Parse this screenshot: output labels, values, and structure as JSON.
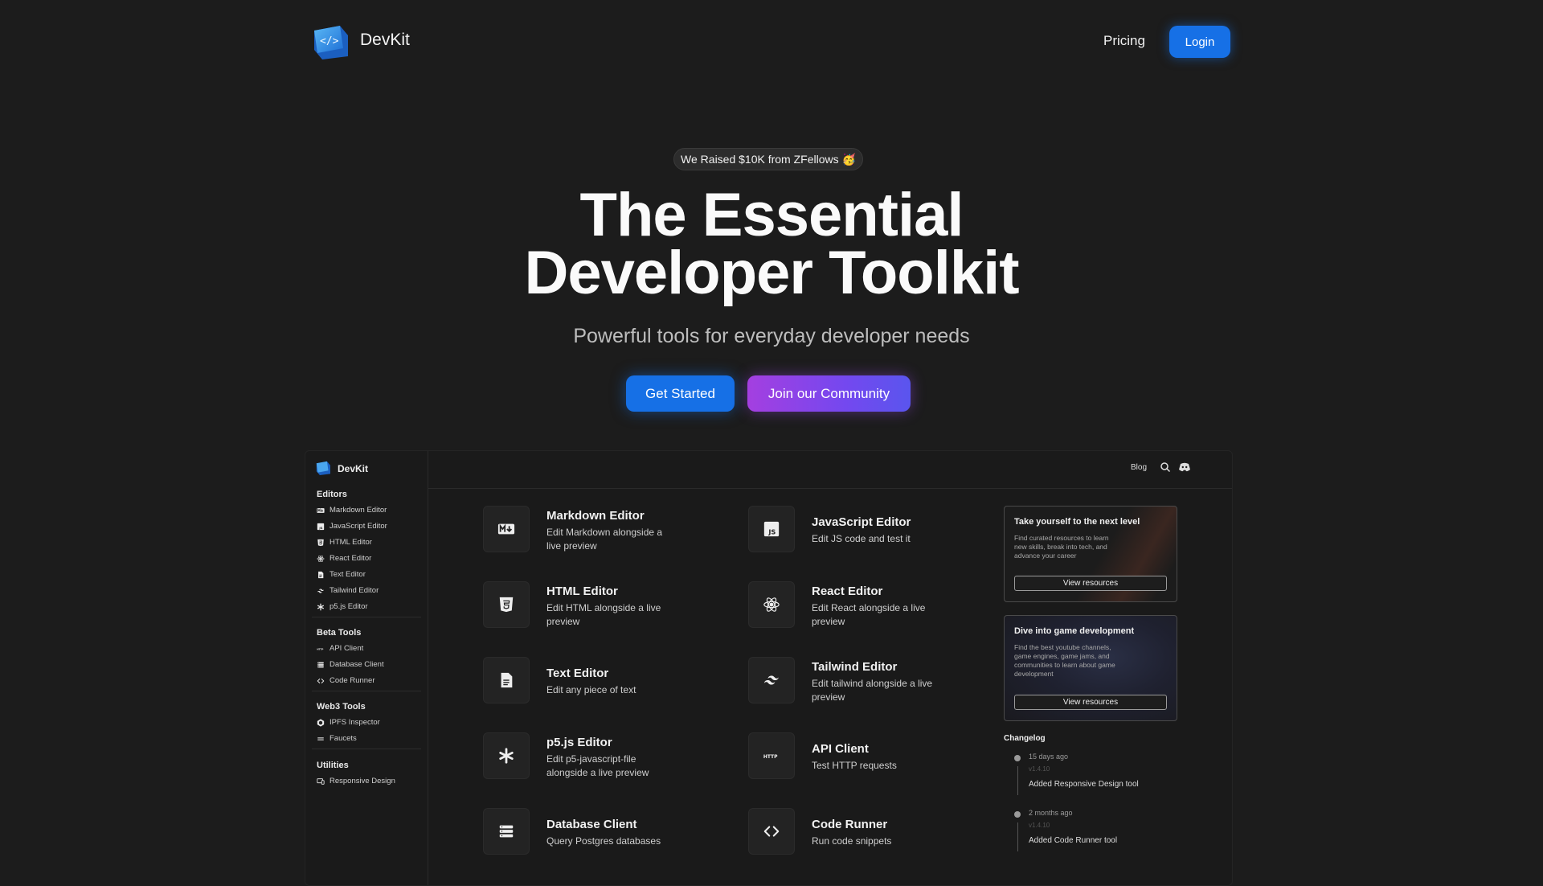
{
  "nav": {
    "brand": "DevKit",
    "pricing": "Pricing",
    "login": "Login"
  },
  "hero": {
    "badge": "We Raised $10K from ZFellows 🥳",
    "title_line1": "The Essential",
    "title_line2": "Developer Toolkit",
    "subtitle": "Powerful tools for everyday developer needs",
    "cta_primary": "Get Started",
    "cta_secondary": "Join our Community"
  },
  "colors": {
    "accent": "#1670e6",
    "community_gradient": [
      "#a43fe0",
      "#5a55ee"
    ],
    "background": "#1c1c1c"
  },
  "app": {
    "brand": "DevKit",
    "topbar": {
      "blog": "Blog",
      "search_icon": "search-icon",
      "discord_icon": "discord-icon"
    },
    "sidebar": {
      "sections": [
        {
          "title": "Editors",
          "items": [
            {
              "label": "Markdown Editor",
              "icon": "markdown-icon"
            },
            {
              "label": "JavaScript Editor",
              "icon": "javascript-icon"
            },
            {
              "label": "HTML Editor",
              "icon": "html5-icon"
            },
            {
              "label": "React Editor",
              "icon": "react-icon"
            },
            {
              "label": "Text Editor",
              "icon": "file-text-icon"
            },
            {
              "label": "Tailwind Editor",
              "icon": "tailwind-icon"
            },
            {
              "label": "p5.js Editor",
              "icon": "asterisk-icon"
            }
          ]
        },
        {
          "title": "Beta Tools",
          "items": [
            {
              "label": "API Client",
              "icon": "http-icon"
            },
            {
              "label": "Database Client",
              "icon": "database-icon"
            },
            {
              "label": "Code Runner",
              "icon": "code-icon"
            }
          ]
        },
        {
          "title": "Web3 Tools",
          "items": [
            {
              "label": "IPFS Inspector",
              "icon": "ipfs-icon"
            },
            {
              "label": "Faucets",
              "icon": "faucet-icon"
            }
          ]
        },
        {
          "title": "Utilities",
          "items": [
            {
              "label": "Responsive Design",
              "icon": "responsive-icon"
            }
          ]
        }
      ]
    },
    "tools": [
      {
        "title": "Markdown Editor",
        "desc": "Edit Markdown alongside a live preview",
        "icon": "markdown-icon"
      },
      {
        "title": "JavaScript Editor",
        "desc": "Edit JS code and test it",
        "icon": "javascript-icon"
      },
      {
        "title": "HTML Editor",
        "desc": "Edit HTML alongside a live preview",
        "icon": "html5-icon"
      },
      {
        "title": "React Editor",
        "desc": "Edit React alongside a live preview",
        "icon": "react-icon"
      },
      {
        "title": "Text Editor",
        "desc": "Edit any piece of text",
        "icon": "file-text-icon"
      },
      {
        "title": "Tailwind Editor",
        "desc": "Edit tailwind alongside a live preview",
        "icon": "tailwind-icon"
      },
      {
        "title": "p5.js Editor",
        "desc": "Edit p5-javascript-file alongside a live preview",
        "icon": "asterisk-icon"
      },
      {
        "title": "API Client",
        "desc": "Test HTTP requests",
        "icon": "http-icon"
      },
      {
        "title": "Database Client",
        "desc": "Query Postgres databases",
        "icon": "database-icon"
      },
      {
        "title": "Code Runner",
        "desc": "Run code snippets",
        "icon": "code-icon"
      }
    ],
    "promos": [
      {
        "title": "Take yourself to the next level",
        "desc": "Find curated resources to learn new skills, break into tech, and advance your career",
        "button": "View resources"
      },
      {
        "title": "Dive into game development",
        "desc": "Find the best youtube channels, game engines, game jams, and communities to learn about game development",
        "button": "View resources"
      }
    ],
    "changelog": {
      "title": "Changelog",
      "entries": [
        {
          "time": "15 days ago",
          "version": "v1.4.10",
          "text": "Added Responsive Design tool"
        },
        {
          "time": "2 months ago",
          "version": "v1.4.10",
          "text": "Added Code Runner tool"
        }
      ]
    }
  }
}
